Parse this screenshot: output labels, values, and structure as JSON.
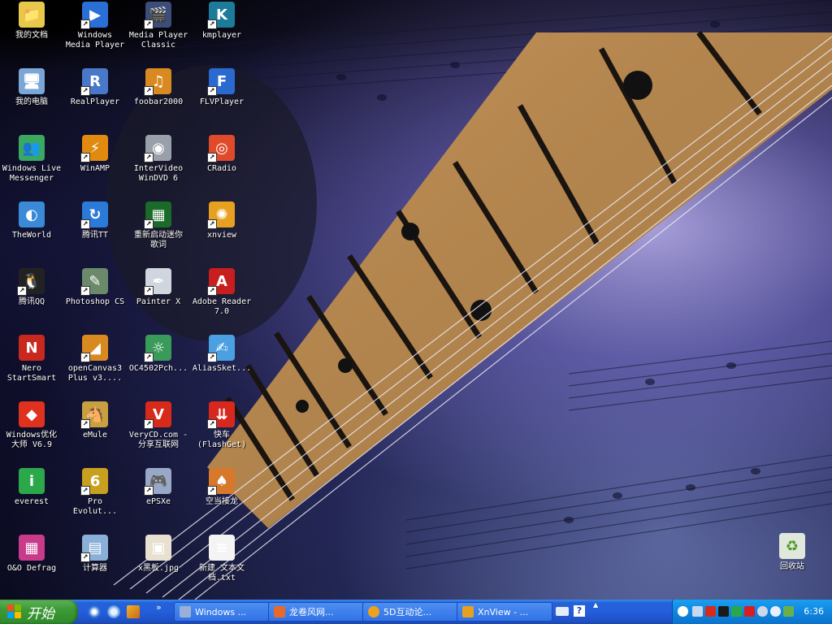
{
  "desktop": {
    "icons": [
      {
        "id": "my-documents",
        "label": "我的文档",
        "color": "#e8c84a",
        "glyph": "📁",
        "shortcut": false
      },
      {
        "id": "windows-media-player",
        "label": "Windows\nMedia Player",
        "color": "#2a6fd6",
        "glyph": "▶",
        "shortcut": true
      },
      {
        "id": "media-player-classic",
        "label": "Media Player\nClassic",
        "color": "#3b4d7a",
        "glyph": "🎬",
        "shortcut": true
      },
      {
        "id": "kmplayer",
        "label": "kmplayer",
        "color": "#1c7a9a",
        "glyph": "K",
        "shortcut": true
      },
      {
        "id": "my-computer",
        "label": "我的电脑",
        "color": "#7aa7d8",
        "glyph": "🖥",
        "shortcut": false
      },
      {
        "id": "realplayer",
        "label": "RealPlayer",
        "color": "#4a78c8",
        "glyph": "R",
        "shortcut": true
      },
      {
        "id": "foobar2000",
        "label": "foobar2000",
        "color": "#d88a20",
        "glyph": "♫",
        "shortcut": true
      },
      {
        "id": "flvplayer",
        "label": "FLVPlayer",
        "color": "#2a6ad0",
        "glyph": "F",
        "shortcut": true
      },
      {
        "id": "windows-live-messenger",
        "label": "Windows Live\nMessenger",
        "color": "#3aa860",
        "glyph": "👥",
        "shortcut": false
      },
      {
        "id": "winamp",
        "label": "WinAMP",
        "color": "#e08a10",
        "glyph": "⚡",
        "shortcut": true
      },
      {
        "id": "intervideo-windvd",
        "label": "InterVideo\nWinDVD 6",
        "color": "#9aa0aa",
        "glyph": "◉",
        "shortcut": true
      },
      {
        "id": "cradio",
        "label": "CRadio",
        "color": "#e04a2a",
        "glyph": "◎",
        "shortcut": true
      },
      {
        "id": "theworld",
        "label": "TheWorld",
        "color": "#3a8ad8",
        "glyph": "◐",
        "shortcut": false
      },
      {
        "id": "tencent-tt",
        "label": "腾讯TT",
        "color": "#2a7ad8",
        "glyph": "↻",
        "shortcut": true
      },
      {
        "id": "restart-lyrics",
        "label": "重新启动迷你\n歌词",
        "color": "#1a6a2a",
        "glyph": "▦",
        "shortcut": true
      },
      {
        "id": "xnview",
        "label": "xnview",
        "color": "#e8a020",
        "glyph": "✺",
        "shortcut": true
      },
      {
        "id": "tencent-qq",
        "label": "腾讯QQ",
        "color": "#222",
        "glyph": "🐧",
        "shortcut": true
      },
      {
        "id": "photoshop-cs",
        "label": "Photoshop CS",
        "color": "#6a8a6a",
        "glyph": "✎",
        "shortcut": true
      },
      {
        "id": "painter-x",
        "label": "Painter X",
        "color": "#cfd6de",
        "glyph": "✒",
        "shortcut": true
      },
      {
        "id": "adobe-reader",
        "label": "Adobe Reader\n7.0",
        "color": "#c81e1e",
        "glyph": "A",
        "shortcut": true
      },
      {
        "id": "nero-startsmart",
        "label": "Nero\nStartSmart",
        "color": "#c8281e",
        "glyph": "N",
        "shortcut": false
      },
      {
        "id": "opencanvas",
        "label": "openCanvas3\nPlus v3....",
        "color": "#d88a20",
        "glyph": "◢",
        "shortcut": true
      },
      {
        "id": "oc4502",
        "label": "OC4502Pch...",
        "color": "#3a9a5a",
        "glyph": "☼",
        "shortcut": true
      },
      {
        "id": "aliassketch",
        "label": "AliasSket...",
        "color": "#4aa0e0",
        "glyph": "✍",
        "shortcut": true
      },
      {
        "id": "windows-optimizer",
        "label": "Windows优化\n大师 V6.9",
        "color": "#e0301e",
        "glyph": "◆",
        "shortcut": false
      },
      {
        "id": "emule",
        "label": "eMule",
        "color": "#c8a040",
        "glyph": "🐴",
        "shortcut": true
      },
      {
        "id": "verycd",
        "label": "VeryCD.com -\n分享互联网",
        "color": "#d82a1a",
        "glyph": "V",
        "shortcut": true
      },
      {
        "id": "flashget",
        "label": "快车\n(FlashGet)",
        "color": "#d8281e",
        "glyph": "⇊",
        "shortcut": true
      },
      {
        "id": "everest",
        "label": "everest",
        "color": "#2aa84a",
        "glyph": "i",
        "shortcut": false
      },
      {
        "id": "pro-evolution",
        "label": "Pro\nEvolut...",
        "color": "#c8a020",
        "glyph": "6",
        "shortcut": true
      },
      {
        "id": "epsxe",
        "label": "ePSXe",
        "color": "#9aa8c8",
        "glyph": "🎮",
        "shortcut": true
      },
      {
        "id": "kongdang-jielong",
        "label": "空当接龙",
        "color": "#d8782a",
        "glyph": "♠",
        "shortcut": true
      },
      {
        "id": "oo-defrag",
        "label": "O&O Defrag",
        "color": "#c83a8a",
        "glyph": "▦",
        "shortcut": false
      },
      {
        "id": "calculator",
        "label": "计算器",
        "color": "#8ab0d8",
        "glyph": "▤",
        "shortcut": true
      },
      {
        "id": "x-blackboard",
        "label": "x黑板.jpg",
        "color": "#e8e0d0",
        "glyph": "▣",
        "shortcut": false
      },
      {
        "id": "new-text-doc",
        "label": "新建 文本文\n档.txt",
        "color": "#f4f4f4",
        "glyph": "≡",
        "shortcut": false
      }
    ],
    "recycle_bin": {
      "label": "回收站",
      "color": "#6ab04a",
      "glyph": "♻"
    }
  },
  "taskbar": {
    "start_label": "开始",
    "chevron": "»",
    "tasks": [
      {
        "label": "Windows ...",
        "color": "#9ab0d8"
      },
      {
        "label": "龙卷风网...",
        "color": "#e86a2a"
      },
      {
        "label": "5D互动论...",
        "color": "#f0a020"
      },
      {
        "label": "XnView - ...",
        "color": "#e8a020"
      }
    ],
    "tray_up_arrow": "▲",
    "clock": "6:36"
  }
}
